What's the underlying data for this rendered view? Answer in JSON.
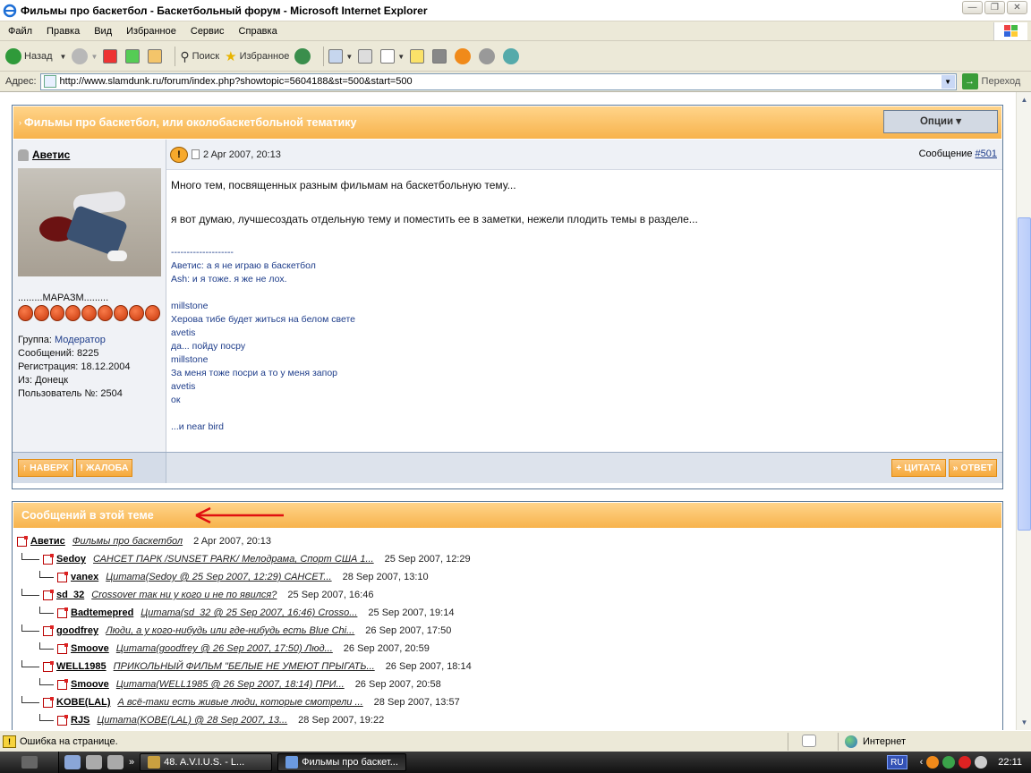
{
  "window": {
    "title": "Фильмы про баскетбол - Баскетбольный форум - Microsoft Internet Explorer",
    "buttons": [
      "—",
      "❐",
      "✕"
    ]
  },
  "menu": [
    "Файл",
    "Правка",
    "Вид",
    "Избранное",
    "Сервис",
    "Справка"
  ],
  "toolbar": {
    "back_label": "Назад",
    "search_label": "Поиск",
    "favorites_label": "Избранное"
  },
  "addressbar": {
    "label": "Адрес:",
    "url": "http://www.slamdunk.ru/forum/index.php?showtopic=5604188&st=500&start=500",
    "go_label": "Переход"
  },
  "post": {
    "topic_title": "Фильмы про баскетбол, или околобаскетбольной тематику",
    "options_label": "Опции ▾",
    "author": "Аветис",
    "rank_title": ".........МАРАЗМ.........",
    "rank_balls": 9,
    "user_info": {
      "group_label": "Группа:",
      "group": "Модератор",
      "messages_label": "Сообщений:",
      "messages": "8225",
      "registered_label": "Регистрация:",
      "registered": "18.12.2004",
      "from_label": "Из:",
      "from": "Донецк",
      "user_no_label": "Пользователь №:",
      "user_no": "2504"
    },
    "date": "2 Apr 2007, 20:13",
    "msg_prefix": "Сообщение",
    "msg_number": "#501",
    "body_line1": "Много тем, посвященных разным фильмам на баскетбольную тему...",
    "body_line2": "я вот думаю, лучшесоздать отдельную тему и поместить ее в заметки, нежели плодить темы в разделе...",
    "signature": [
      "--------------------",
      "Аветис: а я не играю в баскетбол",
      "Ash: и я тоже. я же не лох.",
      "",
      "millstone",
      "Херова тибе будет житься на белом свете",
      "avetis",
      "да... пойду посру",
      "millstone",
      "За меня тоже посри а то у меня запор",
      "avetis",
      "ок",
      "",
      "...и near bird"
    ],
    "btn_top": "↑ НАВЕРХ",
    "btn_report": "! ЖАЛОБА",
    "btn_quote": "+ ЦИТАТА",
    "btn_reply": "» ОТВЕТ"
  },
  "topic_tree": {
    "header": "Сообщений в этой теме",
    "rows": [
      {
        "level": 0,
        "author": "Аветис",
        "title": "Фильмы про баскетбол",
        "date": "2 Apr 2007, 20:13"
      },
      {
        "level": 1,
        "author": "Sedoy",
        "title": "САНСЕТ ПАРК /SUNSET PARK/ Мелодрама, Спорт США 1...",
        "date": "25 Sep 2007, 12:29"
      },
      {
        "level": 2,
        "author": "vanex",
        "title": "Цитата(Sedoy @ 25 Sep 2007, 12:29) САНСЕТ...",
        "date": "28 Sep 2007, 13:10"
      },
      {
        "level": 1,
        "author": "sd_32",
        "title": "Crossover так ни у кого и не по явился?",
        "date": "25 Sep 2007, 16:46"
      },
      {
        "level": 2,
        "author": "Badtemepred",
        "title": "Цитата(sd_32 @ 25 Sep 2007, 16:46) Crosso...",
        "date": "25 Sep 2007, 19:14"
      },
      {
        "level": 1,
        "author": "goodfrey",
        "title": "Люди, а у кого-нибудь или где-нибудь есть Blue Chi...",
        "date": "26 Sep 2007, 17:50"
      },
      {
        "level": 2,
        "author": "Smoove",
        "title": "Цитата(goodfrey @ 26 Sep 2007, 17:50) Люд...",
        "date": "26 Sep 2007, 20:59"
      },
      {
        "level": 1,
        "author": "WELL1985",
        "title": "ПРИКОЛЬНЫЙ ФИЛЬМ \"БЕЛЫЕ НЕ УМЕЮТ ПРЫГАТЬ...",
        "date": "26 Sep 2007, 18:14"
      },
      {
        "level": 2,
        "author": "Smoove",
        "title": "Цитата(WELL1985 @ 26 Sep 2007, 18:14) ПРИ...",
        "date": "26 Sep 2007, 20:58"
      },
      {
        "level": 1,
        "author": "KOBE(LAL)",
        "title": "А всё-таки есть живые люди, которые смотрели ...",
        "date": "28 Sep 2007, 13:57"
      },
      {
        "level": 2,
        "author": "RJS",
        "title": "Цитата(KOBE(LAL) @ 28 Sep 2007, 13...",
        "date": "28 Sep 2007, 19:22"
      }
    ]
  },
  "statusbar": {
    "status": "Ошибка на странице.",
    "zone": "Интернет"
  },
  "taskbar": {
    "tasks": [
      "48. A.V.I.U.S.        - L...",
      "Фильмы про баскет..."
    ],
    "lang": "RU",
    "clock": "22:11"
  },
  "colors": {
    "header_orange": "#f7b34c",
    "link_blue": "#1d3c8a",
    "annotation_red": "#e01010"
  }
}
